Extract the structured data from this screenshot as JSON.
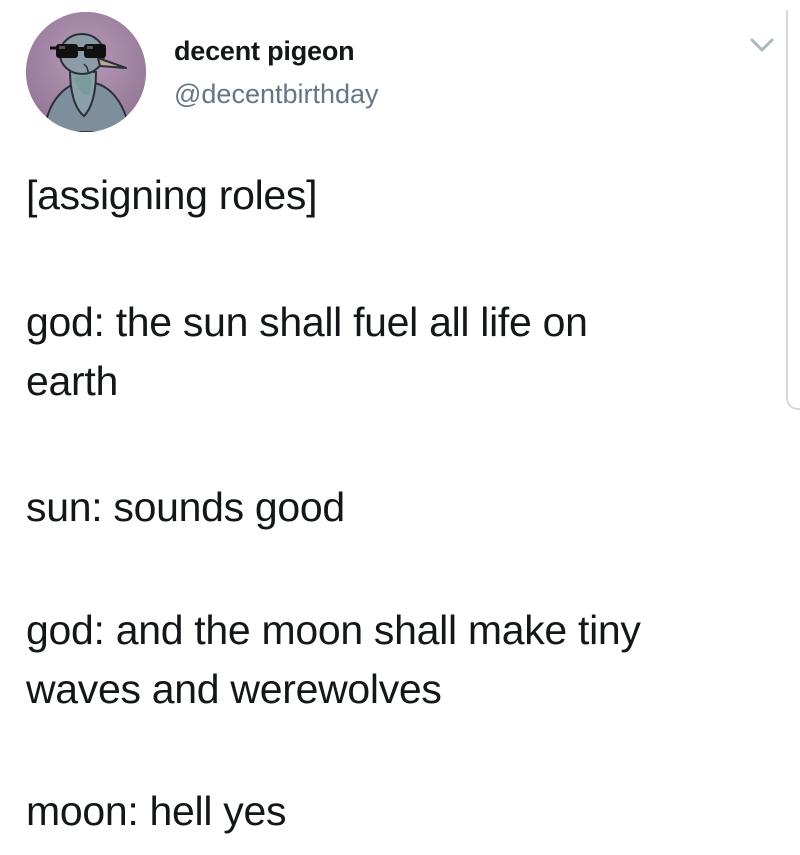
{
  "user": {
    "display_name": "decent pigeon",
    "handle": "@decentbirthday",
    "avatar_icon": "pigeon-with-sunglasses-avatar",
    "menu_icon": "chevron-down-icon"
  },
  "tweet": {
    "lines": [
      "[assigning roles]",
      "god: the sun shall fuel all life on",
      "earth",
      "sun: sounds good",
      "god: and the moon shall make tiny",
      "waves and werewolves",
      "moon: hell yes"
    ]
  },
  "colors": {
    "text": "#14171a",
    "handle": "#657786",
    "avatar_bg": "#a58aa7",
    "background": "#ffffff"
  }
}
